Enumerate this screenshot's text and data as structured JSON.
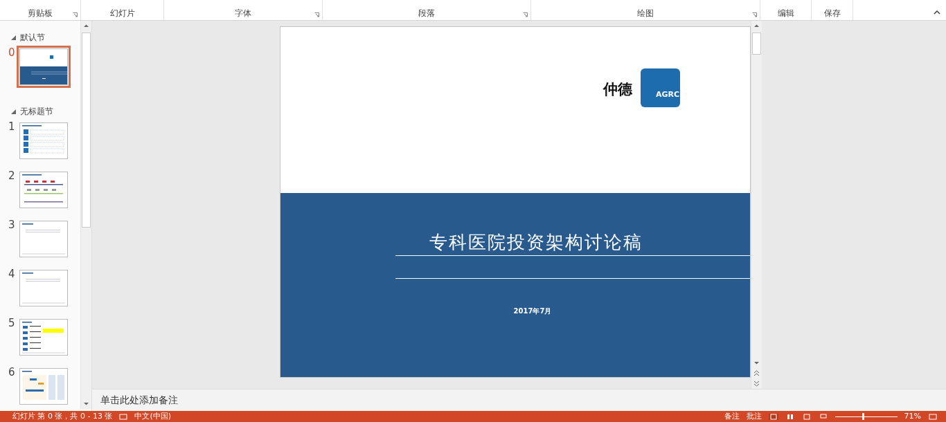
{
  "ribbon": {
    "groups": [
      {
        "label": "剪贴板",
        "launcher": true
      },
      {
        "label": "幻灯片",
        "launcher": false
      },
      {
        "label": "字体",
        "launcher": true
      },
      {
        "label": "段落",
        "launcher": true
      },
      {
        "label": "绘图",
        "launcher": true
      },
      {
        "label": "编辑",
        "launcher": false
      },
      {
        "label": "保存",
        "launcher": false
      }
    ]
  },
  "sections": [
    {
      "name": "默认节",
      "expanded": true,
      "slides": [
        {
          "number": "0",
          "kind": "title",
          "selected": true
        }
      ]
    },
    {
      "name": "无标题节",
      "expanded": true,
      "slides": [
        {
          "number": "1",
          "kind": "list",
          "selected": false
        },
        {
          "number": "2",
          "kind": "timeline",
          "selected": false
        },
        {
          "number": "3",
          "kind": "text",
          "selected": false
        },
        {
          "number": "4",
          "kind": "text",
          "selected": false
        },
        {
          "number": "5",
          "kind": "table",
          "selected": false
        },
        {
          "number": "6",
          "kind": "diagram",
          "selected": false
        }
      ]
    }
  ],
  "slide": {
    "brand": "仲德",
    "logo_text": "AGRC",
    "title": "专科医院投资架构讨论稿",
    "date": "2017年7月"
  },
  "notes": {
    "placeholder": "单击此处添加备注"
  },
  "status_bar": {
    "slide_info": "幻灯片 第 0 张，共 0 - 13 张",
    "language": "中文(中国)",
    "notes_button": "备注",
    "comments_button": "批注",
    "zoom_slider": {
      "level": 0.45
    },
    "zoom": "71%"
  }
}
